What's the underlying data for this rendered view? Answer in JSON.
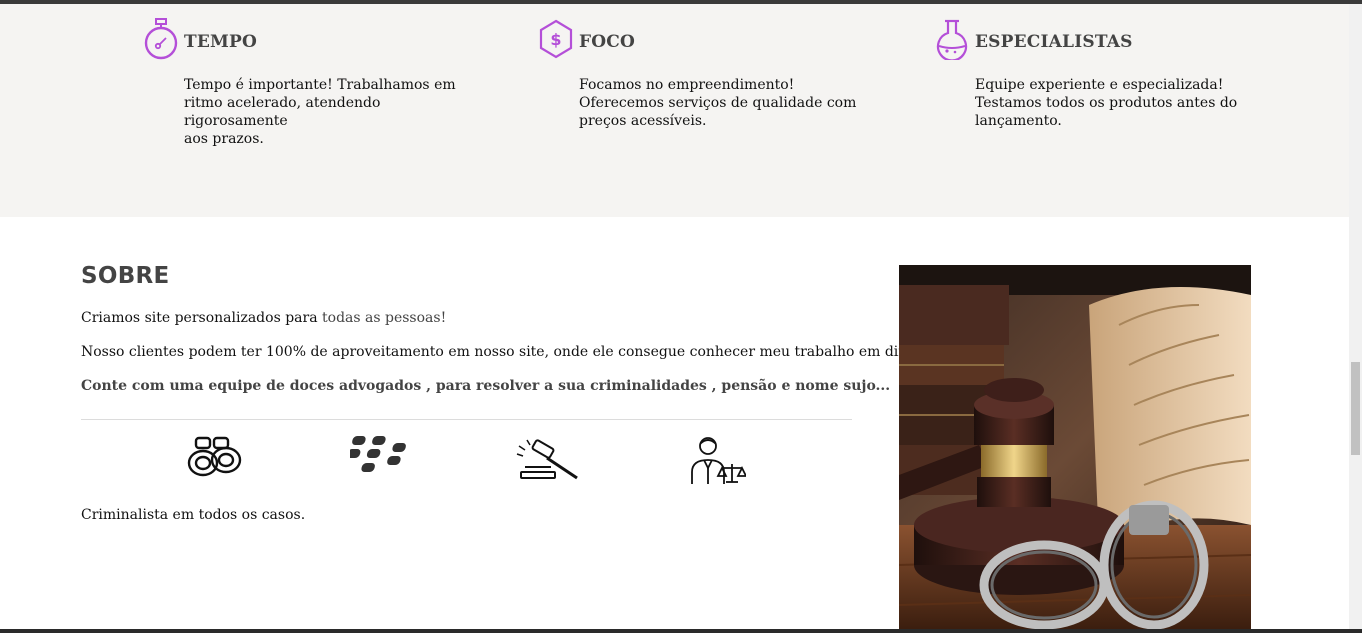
{
  "features": [
    {
      "icon": "stopwatch-icon",
      "title": "TEMPO",
      "lines": [
        "Tempo é importante! Trabalhamos em",
        "ritmo acelerado, atendendo rigorosamente",
        "aos prazos."
      ]
    },
    {
      "icon": "dollar-hexagon-icon",
      "title": "FOCO",
      "lines": [
        "Focamos no empreendimento!",
        "Oferecemos serviços de qualidade com",
        "preços acessíveis."
      ]
    },
    {
      "icon": "flask-icon",
      "title": "ESPECIALISTAS",
      "lines": [
        "Equipe experiente e especializada!",
        "Testamos todos os produtos antes do",
        "lançamento."
      ]
    }
  ],
  "accent_color": "#b44fd8",
  "about": {
    "title": "SOBRE",
    "p1_prefix": "Criamos site personalizados para ",
    "p1_highlight": "todas as pessoas!",
    "p2": "Nosso clientes podem ter 100% de aproveitamento em nosso site, onde ele consegue conhecer meu trabalho em direitos.",
    "p3": "Conte com uma equipe de doces advogados , para resolver a sua criminalidades , pensão e nome sujo...",
    "footer_text": "Criminalista em todos os casos."
  },
  "logos": [
    "handcuffs-icon",
    "blackberry-icon",
    "gavel-icon",
    "lawyer-icon"
  ],
  "image": {
    "subject": "gavel-and-handcuffs-photo"
  }
}
